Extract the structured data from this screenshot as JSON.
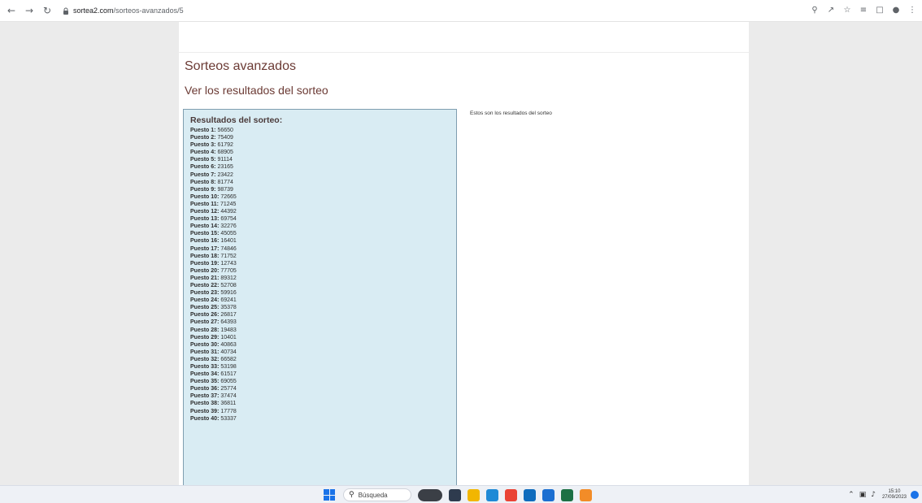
{
  "browser": {
    "url_host": "sortea2.com",
    "url_path": "/sorteos-avanzados/5",
    "icons": [
      "back-icon",
      "forward-icon",
      "reload-icon",
      "lock-icon",
      "zoom-icon",
      "share-icon",
      "bookmark-star-icon",
      "reading-list-icon",
      "side-panel-icon",
      "profile-icon",
      "menu-icon"
    ]
  },
  "page": {
    "title": "Sorteos avanzados",
    "subtitle": "Ver los resultados del sorteo",
    "results_heading": "Resultados del sorteo:",
    "side_note": "Estos son los resultados del sorteo",
    "results": [
      {
        "label": "Puesto 1:",
        "value": "56650"
      },
      {
        "label": "Puesto 2:",
        "value": "75409"
      },
      {
        "label": "Puesto 3:",
        "value": "61792"
      },
      {
        "label": "Puesto 4:",
        "value": "68905"
      },
      {
        "label": "Puesto 5:",
        "value": "91114"
      },
      {
        "label": "Puesto 6:",
        "value": "23165"
      },
      {
        "label": "Puesto 7:",
        "value": "23422"
      },
      {
        "label": "Puesto 8:",
        "value": "81774"
      },
      {
        "label": "Puesto 9:",
        "value": "98739"
      },
      {
        "label": "Puesto 10:",
        "value": "72665"
      },
      {
        "label": "Puesto 11:",
        "value": "71245"
      },
      {
        "label": "Puesto 12:",
        "value": "44392"
      },
      {
        "label": "Puesto 13:",
        "value": "69754"
      },
      {
        "label": "Puesto 14:",
        "value": "32276"
      },
      {
        "label": "Puesto 15:",
        "value": "45055"
      },
      {
        "label": "Puesto 16:",
        "value": "16401"
      },
      {
        "label": "Puesto 17:",
        "value": "74846"
      },
      {
        "label": "Puesto 18:",
        "value": "71752"
      },
      {
        "label": "Puesto 19:",
        "value": "12743"
      },
      {
        "label": "Puesto 20:",
        "value": "77705"
      },
      {
        "label": "Puesto 21:",
        "value": "89312"
      },
      {
        "label": "Puesto 22:",
        "value": "52708"
      },
      {
        "label": "Puesto 23:",
        "value": "59916"
      },
      {
        "label": "Puesto 24:",
        "value": "69241"
      },
      {
        "label": "Puesto 25:",
        "value": "35378"
      },
      {
        "label": "Puesto 26:",
        "value": "26817"
      },
      {
        "label": "Puesto 27:",
        "value": "64393"
      },
      {
        "label": "Puesto 28:",
        "value": "19483"
      },
      {
        "label": "Puesto 29:",
        "value": "10401"
      },
      {
        "label": "Puesto 30:",
        "value": "40863"
      },
      {
        "label": "Puesto 31:",
        "value": "40734"
      },
      {
        "label": "Puesto 32:",
        "value": "66582"
      },
      {
        "label": "Puesto 33:",
        "value": "53198"
      },
      {
        "label": "Puesto 34:",
        "value": "61517"
      },
      {
        "label": "Puesto 35:",
        "value": "69055"
      },
      {
        "label": "Puesto 36:",
        "value": "25774"
      },
      {
        "label": "Puesto 37:",
        "value": "37474"
      },
      {
        "label": "Puesto 38:",
        "value": "36811"
      },
      {
        "label": "Puesto 39:",
        "value": "17778"
      },
      {
        "label": "Puesto 40:",
        "value": "53337"
      },
      {
        "label": "",
        "value": ""
      }
    ]
  },
  "taskbar": {
    "search_label": "Búsqueda",
    "time": "15:10",
    "date": "27/09/2023",
    "apps": [
      {
        "name": "taskbar-app-cloud",
        "color": "#3b3f46"
      },
      {
        "name": "taskbar-app-files",
        "color": "#2e3b4e"
      },
      {
        "name": "taskbar-app-explorer",
        "color": "#f2b600"
      },
      {
        "name": "taskbar-app-edge",
        "color": "#1f8ad6"
      },
      {
        "name": "taskbar-app-chrome",
        "color": "#ea4335"
      },
      {
        "name": "taskbar-app-outlook",
        "color": "#0f6cbd"
      },
      {
        "name": "taskbar-app-mail",
        "color": "#1b6fd1"
      },
      {
        "name": "taskbar-app-excel",
        "color": "#1d7044"
      },
      {
        "name": "taskbar-app-misc",
        "color": "#f28c28"
      }
    ]
  },
  "colors": {
    "title": "#6b3a34",
    "panel_bg": "#d9ecf3",
    "panel_border": "#7f9eb0",
    "page_bg": "#ebebeb"
  }
}
